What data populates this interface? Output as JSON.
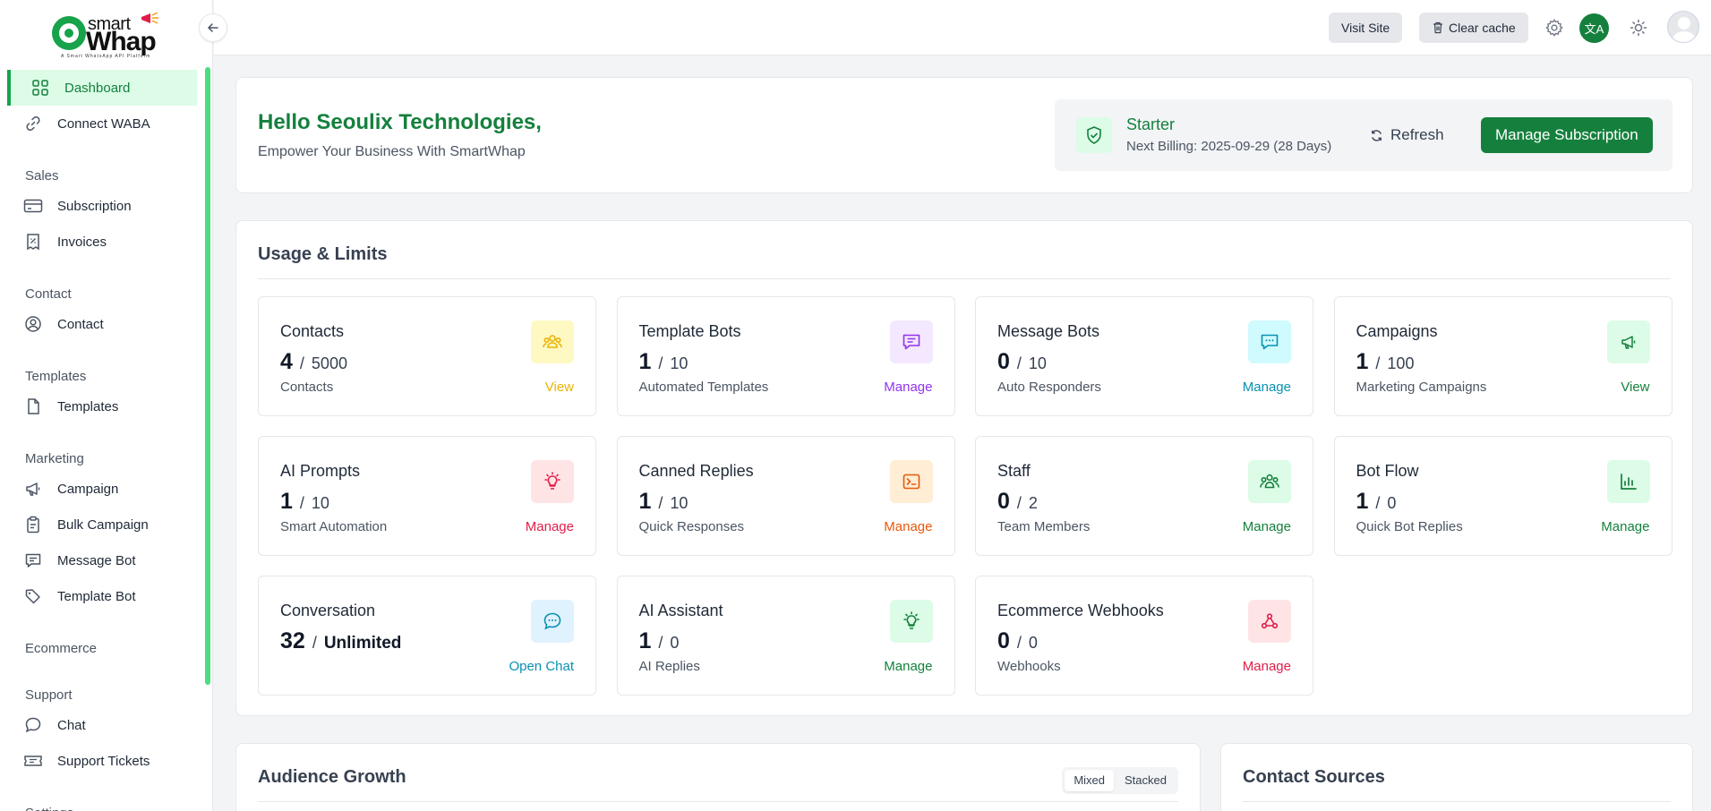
{
  "brand": {
    "word1": "smart",
    "word2": "Whap",
    "tagline": "A Smart WhatsApp API Platform"
  },
  "sidebar": {
    "items": [
      {
        "label": "Dashboard",
        "icon": "grid-icon",
        "active": true
      },
      {
        "label": "Connect WABA",
        "icon": "link-icon"
      },
      {
        "section": "Sales"
      },
      {
        "label": "Subscription",
        "icon": "credit-card-icon"
      },
      {
        "label": "Invoices",
        "icon": "receipt-icon"
      },
      {
        "section": "Contact"
      },
      {
        "label": "Contact",
        "icon": "user-circle-icon"
      },
      {
        "section": "Templates"
      },
      {
        "label": "Templates",
        "icon": "file-icon"
      },
      {
        "section": "Marketing"
      },
      {
        "label": "Campaign",
        "icon": "megaphone-icon"
      },
      {
        "label": "Bulk Campaign",
        "icon": "clipboard-icon"
      },
      {
        "label": "Message Bot",
        "icon": "message-icon"
      },
      {
        "label": "Template Bot",
        "icon": "tag-icon"
      },
      {
        "section": "Ecommerce"
      },
      {
        "section": "Support"
      },
      {
        "label": "Chat",
        "icon": "chat-bubble-icon"
      },
      {
        "label": "Support Tickets",
        "icon": "ticket-icon"
      },
      {
        "section": "Settings"
      }
    ]
  },
  "topbar": {
    "visit_site": "Visit Site",
    "clear_cache": "Clear cache",
    "lang_glyph": "文A"
  },
  "hello": {
    "title": "Hello Seoulix Technologies,",
    "subtitle": "Empower Your Business With SmartWhap"
  },
  "plan": {
    "name": "Starter",
    "billing": "Next Billing: 2025-09-29 (28 Days)",
    "refresh": "Refresh",
    "manage": "Manage Subscription"
  },
  "usage": {
    "title": "Usage & Limits",
    "stats": [
      {
        "title": "Contacts",
        "used": "4",
        "limit": "5000",
        "sub": "Contacts",
        "link": "View",
        "color": "#eab308",
        "bg": "#fef9c3",
        "icon": "users-icon"
      },
      {
        "title": "Template Bots",
        "used": "1",
        "limit": "10",
        "sub": "Automated Templates",
        "link": "Manage",
        "color": "#9333ea",
        "bg": "#f3e8ff",
        "icon": "message-lines-icon"
      },
      {
        "title": "Message Bots",
        "used": "0",
        "limit": "10",
        "sub": "Auto Responders",
        "link": "Manage",
        "color": "#0891b2",
        "bg": "#cffafe",
        "icon": "chat-dots-icon"
      },
      {
        "title": "Campaigns",
        "used": "1",
        "limit": "100",
        "sub": "Marketing Campaigns",
        "link": "View",
        "color": "#15803d",
        "bg": "#dcfce7",
        "icon": "megaphone-icon"
      },
      {
        "title": "AI Prompts",
        "used": "1",
        "limit": "10",
        "sub": "Smart Automation",
        "link": "Manage",
        "color": "#e11d48",
        "bg": "#ffe4e6",
        "icon": "bulb-icon"
      },
      {
        "title": "Canned Replies",
        "used": "1",
        "limit": "10",
        "sub": "Quick Responses",
        "link": "Manage",
        "color": "#ea580c",
        "bg": "#ffedd5",
        "icon": "terminal-icon"
      },
      {
        "title": "Staff",
        "used": "0",
        "limit": "2",
        "sub": "Team Members",
        "link": "Manage",
        "color": "#15803d",
        "bg": "#dcfce7",
        "icon": "team-icon"
      },
      {
        "title": "Bot Flow",
        "used": "1",
        "limit": "0",
        "sub": "Quick Bot Replies",
        "link": "Manage",
        "color": "#15803d",
        "bg": "#dcfce7",
        "icon": "chart-icon"
      },
      {
        "title": "Conversation",
        "used": "32",
        "limit": "Unlimited",
        "sub": "",
        "link": "Open Chat",
        "color": "#0891b2",
        "bg": "#e0f2fe",
        "icon": "conversation-icon"
      },
      {
        "title": "AI Assistant",
        "used": "1",
        "limit": "0",
        "sub": "AI Replies",
        "link": "Manage",
        "color": "#15803d",
        "bg": "#dcfce7",
        "icon": "bulb-icon"
      },
      {
        "title": "Ecommerce Webhooks",
        "used": "0",
        "limit": "0",
        "sub": "Webhooks",
        "link": "Manage",
        "color": "#e11d48",
        "bg": "#ffe4e6",
        "icon": "webhook-icon"
      }
    ]
  },
  "audience": {
    "title": "Audience Growth",
    "toggle": [
      "Mixed",
      "Stacked"
    ],
    "active_toggle": "Mixed"
  },
  "sources": {
    "title": "Contact Sources"
  }
}
